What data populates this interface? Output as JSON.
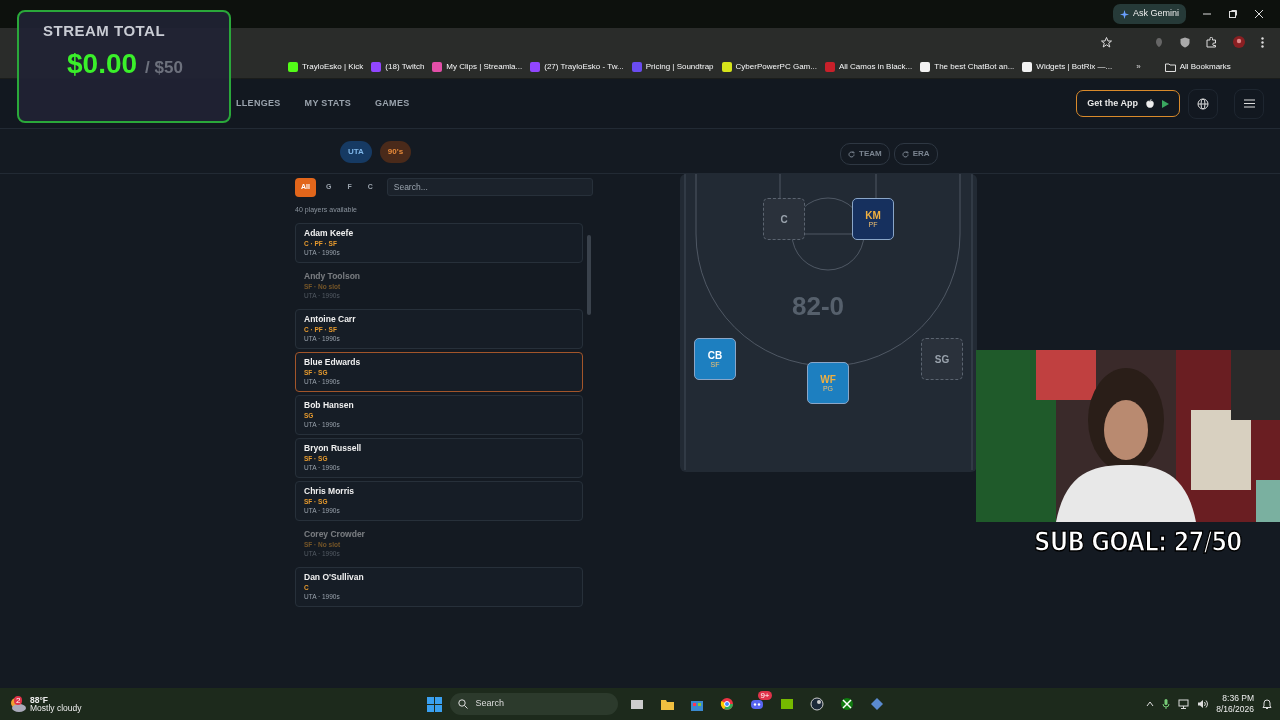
{
  "browser": {
    "ask_gemini": "Ask Gemini",
    "bookmarks": [
      {
        "label": "TrayloEsko | Kick",
        "color": "#53fc18"
      },
      {
        "label": "(18) Twitch",
        "color": "#9146ff"
      },
      {
        "label": "My Clips | Streamla...",
        "color": "#e34fa8"
      },
      {
        "label": "(27) TrayloEsko - Tw...",
        "color": "#9146ff"
      },
      {
        "label": "Pricing | Soundtrap",
        "color": "#6a4cf0"
      },
      {
        "label": "CyberPowerPC Gam...",
        "color": "#d6e41a"
      },
      {
        "label": "All Camos in Black...",
        "color": "#c8202a"
      },
      {
        "label": "The best ChatBot an...",
        "color": "#f2f2f2"
      },
      {
        "label": "Widgets | BotRix —...",
        "color": "#f2f2f2"
      }
    ],
    "more": "»",
    "all_bookmarks": "All Bookmarks"
  },
  "site_nav": {
    "items": [
      "LLENGES",
      "MY STATS",
      "GAMES"
    ],
    "get_app": "Get the App"
  },
  "filters": {
    "chips": [
      {
        "label": "UTA",
        "kind": "team"
      },
      {
        "label": "90's",
        "kind": "era"
      }
    ],
    "rerolls": [
      "TEAM",
      "ERA"
    ]
  },
  "positions": [
    {
      "label": "All",
      "selected": true
    },
    {
      "label": "G",
      "selected": false
    },
    {
      "label": "F",
      "selected": false
    },
    {
      "label": "C",
      "selected": false
    }
  ],
  "search": {
    "placeholder": "Search..."
  },
  "count": "40 players available",
  "players": [
    {
      "name": "Adam Keefe",
      "positions": "C · PF · SF",
      "team": "UTA · 1990s",
      "disabled": false,
      "highlighted": false
    },
    {
      "name": "Andy Toolson",
      "positions": "SF · No slot",
      "team": "UTA · 1990s",
      "disabled": true,
      "highlighted": false
    },
    {
      "name": "Antoine Carr",
      "positions": "C · PF · SF",
      "team": "UTA · 1990s",
      "disabled": false,
      "highlighted": false
    },
    {
      "name": "Blue Edwards",
      "positions": "SF · SG",
      "team": "UTA · 1990s",
      "disabled": false,
      "highlighted": true
    },
    {
      "name": "Bob Hansen",
      "positions": "SG",
      "team": "UTA · 1990s",
      "disabled": false,
      "highlighted": false
    },
    {
      "name": "Bryon Russell",
      "positions": "SF · SG",
      "team": "UTA · 1990s",
      "disabled": false,
      "highlighted": false
    },
    {
      "name": "Chris Morris",
      "positions": "SF · SG",
      "team": "UTA · 1990s",
      "disabled": false,
      "highlighted": false
    },
    {
      "name": "Corey Crowder",
      "positions": "SF · No slot",
      "team": "UTA · 1990s",
      "disabled": true,
      "highlighted": false
    },
    {
      "name": "Dan O'Sullivan",
      "positions": "C",
      "team": "UTA · 1990s",
      "disabled": false,
      "highlighted": false
    }
  ],
  "court": {
    "logo_text": "82-0",
    "slots": [
      {
        "label": "C",
        "filled": false,
        "color": "#2a313b"
      },
      {
        "label": "KM",
        "position": "PF",
        "filled": true,
        "color": "#16305e"
      },
      {
        "label": "CB",
        "position": "SF",
        "filled": true,
        "color": "#1d7fc0"
      },
      {
        "label": "WF",
        "position": "PG",
        "filled": true,
        "color": "#1d7fc0"
      },
      {
        "label": "SG",
        "filled": false,
        "color": "#2a313b"
      }
    ]
  },
  "stream_overlay": {
    "title": "STREAM TOTAL",
    "amount": "$0.00",
    "goal": "/ $50"
  },
  "sub_goal": "SUB GOAL: 27/50",
  "taskbar": {
    "weather_temp": "88°F",
    "weather_text": "Mostly cloudy",
    "weather_badge": "2",
    "search": "Search",
    "discord_badge": "9+",
    "time": "8:36 PM",
    "date": "8/16/2026"
  }
}
